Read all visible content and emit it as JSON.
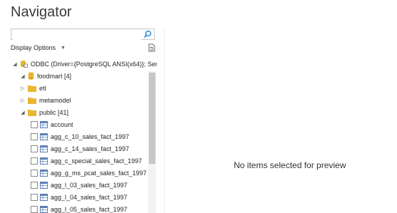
{
  "window": {
    "title": "Navigator"
  },
  "search": {
    "value": "",
    "placeholder": ""
  },
  "display_options": {
    "label": "Display Options"
  },
  "tree": {
    "root": {
      "label": "ODBC (Driver={PostgreSQL ANSI(x64)}; Serv...",
      "expanded": true
    },
    "database": {
      "label": "foodmart [4]",
      "expanded": true
    },
    "schemas": [
      {
        "label": "etl",
        "expanded": false
      },
      {
        "label": "metamodel",
        "expanded": false
      },
      {
        "label": "public [41]",
        "expanded": true
      }
    ],
    "tables": [
      {
        "label": "account",
        "checked": false
      },
      {
        "label": "agg_c_10_sales_fact_1997",
        "checked": false
      },
      {
        "label": "agg_c_14_sales_fact_1997",
        "checked": false
      },
      {
        "label": "agg_c_special_sales_fact_1997",
        "checked": false
      },
      {
        "label": "agg_g_ms_pcat_sales_fact_1997",
        "checked": false
      },
      {
        "label": "agg_l_03_sales_fact_1997",
        "checked": false
      },
      {
        "label": "agg_l_04_sales_fact_1997",
        "checked": false
      },
      {
        "label": "agg_l_05_sales_fact_1997",
        "checked": false
      }
    ]
  },
  "preview": {
    "empty_message": "No items selected for preview"
  },
  "colors": {
    "folder": "#e8b630",
    "database": "#e8b630",
    "table_icon": "#5b7fb5",
    "accent": "#0078d4"
  }
}
